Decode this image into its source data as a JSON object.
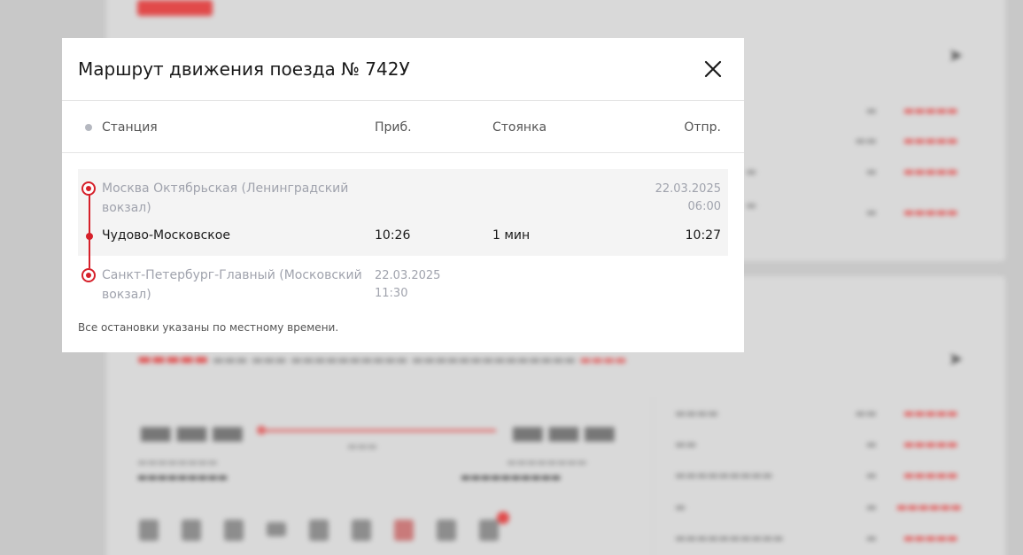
{
  "modal": {
    "title": "Маршрут движения поезда № 742У",
    "columns": {
      "station": "Станция",
      "arrival": "Приб.",
      "stop": "Стоянка",
      "departure": "Отпр."
    },
    "stops": [
      {
        "name_line1": "Москва Октябрьская (Ленинградский",
        "name_line2": "вокзал)",
        "arrival": "",
        "stop": "",
        "departure_date": "22.03.2025",
        "departure_time": "06:00"
      },
      {
        "name": "Чудово-Московское",
        "arrival": "10:26",
        "stop": "1 мин",
        "departure": "10:27"
      },
      {
        "name_line1": "Санкт-Петербург-Главный (Московский",
        "name_line2": "вокзал)",
        "arrival_date": "22.03.2025",
        "arrival_time": "11:30",
        "stop": "",
        "departure": ""
      }
    ],
    "footnote": "Все остановки указаны по местному времени."
  },
  "colors": {
    "accent": "#d6202a",
    "muted_text": "#a0a3ad",
    "overlay": "#c8c8c8"
  },
  "icons": {
    "close": "close-icon",
    "share": "share-icon"
  }
}
